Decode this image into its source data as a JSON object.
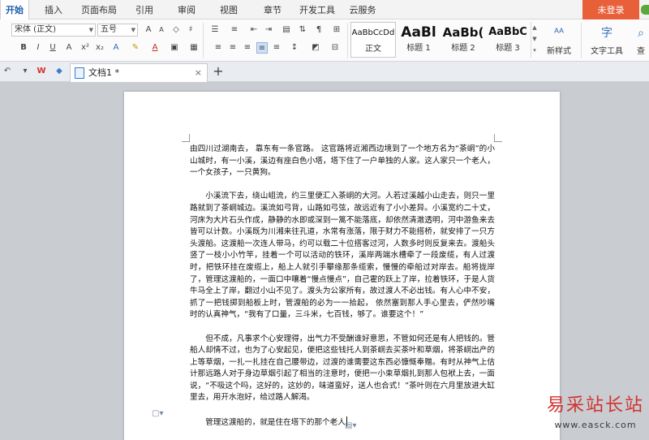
{
  "tabs": [
    "开始",
    "插入",
    "页面布局",
    "引用",
    "审阅",
    "视图",
    "章节",
    "开发工具",
    "云服务"
  ],
  "login_label": "未登录",
  "ribbon": {
    "font_name": "宋体 (正文)",
    "font_size": "五号",
    "styles": [
      {
        "sample": "AaBbCcDd",
        "name": "正文"
      },
      {
        "sample": "AaBl",
        "name": "标题 1"
      },
      {
        "sample": "AaBb(",
        "name": "标题 2"
      },
      {
        "sample": "AaBbC",
        "name": "标题 3"
      }
    ],
    "new_style_label": "新样式",
    "text_tools_label": "文字工具",
    "find_label": "查"
  },
  "doc_tab": {
    "name": "文档1 *",
    "close": "×",
    "add": "+"
  },
  "document": {
    "p1": "由四川过湖南去， 靠东有一条官路。 这官路将近湘西边境到了一个地方名为“茶峒”的小山城时，有一小溪，溪边有座白色小塔，塔下住了一户单独的人家。这人家只一个老人，一个女孩子，一只黄狗。",
    "p2": "小溪流下去，绕山岨流，约三里便汇入茶峒的大河。人若过溪越小山走去，则只一里路就到了茶峒城边。溪流如弓背，山路如弓弦，故远近有了小小差异。小溪宽约二十丈，河床为大片石头作成，静静的水即或深到一篙不能落底，却依然清澈透明，河中游鱼来去皆可以计数。小溪既为川湘来往孔道，水常有涨落，限于财力不能搭桥，就安排了一只方头渡船。这渡船一次连人带马，约可以载二十位搭客过河，人数多时则反复来去。渡船头竖了一枝小小竹竿，挂着一个可以活动的铁环，溪岸两端水槽牵了一段废缆，有人过渡时，把铁环挂在废缆上，船上人就引手攀缘那条缆索，慢慢的牵船过对岸去。船将拢岸了，管理这渡船的，一面口中嚷着“慢点慢点”，自己霍的跃上了岸，拉着铁环，于是人货牛马全上了岸，翻过小山不见了。渡头为公家所有，故过渡人不必出钱。有人心中不安，抓了一把钱掷到船板上时，管渡船的必为一一拾起，  依然塞到那人手心里去，俨然吵嘴时的认真神气，“我有了口量，三斗米，七百钱，够了。谁要这个！”",
    "p3": "但不成，凡事求个心安理得，出气力不受酬谁好意思，不管如何还是有人把钱的。管船人却情不过，也为了心安起见，便把这些钱托人到茶峒去买茶叶和草烟，将茶峒出产的上等草烟，一扎一扎挂在自己腰带边，过渡的谁需要这东西必慷慨奉赠。有时从神气上估计那远路人对于身边草烟引起了相当的注意时，便把一小束草烟扎到那人包袱上去，一面说，“不吸这个吗，这好的，这妙的，味道蛮好，送人也合式！”茶叶则在六月里放进大缸里去，用开水泡好，给过路人解渴。",
    "p4": "管理这渡船的，就是住在塔下的那个老人"
  },
  "watermark": {
    "main": "易采站长站",
    "url": "www.easck.com"
  }
}
